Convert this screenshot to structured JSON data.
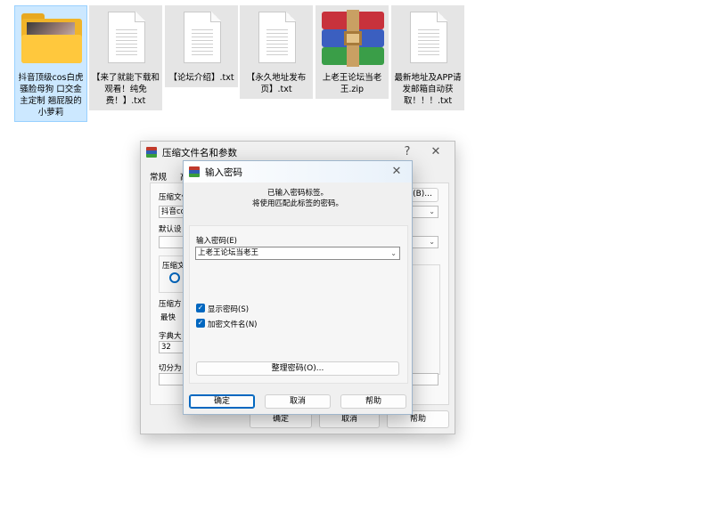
{
  "desktop": {
    "files": [
      {
        "label": "抖音顶级cos白虎骚脸母狗 口交金主定制 翘屁股的小萝莉",
        "kind": "folder",
        "selected": true
      },
      {
        "label": "【来了就能下载和观看！纯免费！】.txt",
        "kind": "text"
      },
      {
        "label": "【论坛介绍】.txt",
        "kind": "text"
      },
      {
        "label": "【永久地址发布页】.txt",
        "kind": "text"
      },
      {
        "label": "上老王论坛当老王.zip",
        "kind": "archive"
      },
      {
        "label": "最新地址及APP请发邮箱自动获取！！！.txt",
        "kind": "text"
      }
    ]
  },
  "archive_dialog": {
    "title": "压缩文件名和参数",
    "help_glyph": "?",
    "close_glyph": "✕",
    "tab_general": "常规",
    "tab_advanced": "高",
    "archive_name_label": "压缩文件",
    "archive_name_value": "抖音co",
    "browse_button": "(B)...",
    "default_label": "默认设",
    "format_label": "压缩文",
    "method_label": "压缩方",
    "method_value": "最快",
    "dict_label": "字典大",
    "dict_value": "32",
    "split_label": "切分为",
    "ok_button": "确定",
    "cancel_button": "取消",
    "help_button": "帮助"
  },
  "password_dialog": {
    "title": "输入密码",
    "close_glyph": "✕",
    "info_line1": "已输入密码标签。",
    "info_line2": "将使用匹配此标签的密码。",
    "password_label": "输入密码(E)",
    "password_value": "上老王论坛当老王",
    "show_password_label": "显示密码(S)",
    "show_password_checked": true,
    "encrypt_names_label": "加密文件名(N)",
    "encrypt_names_checked": true,
    "organize_button": "整理密码(O)...",
    "ok_button": "确定",
    "cancel_button": "取消",
    "help_button": "帮助"
  },
  "icons": {
    "check": "✓",
    "chevron": "⌄"
  },
  "colors": {
    "accent": "#0067c0",
    "selection": "#cce8ff"
  }
}
